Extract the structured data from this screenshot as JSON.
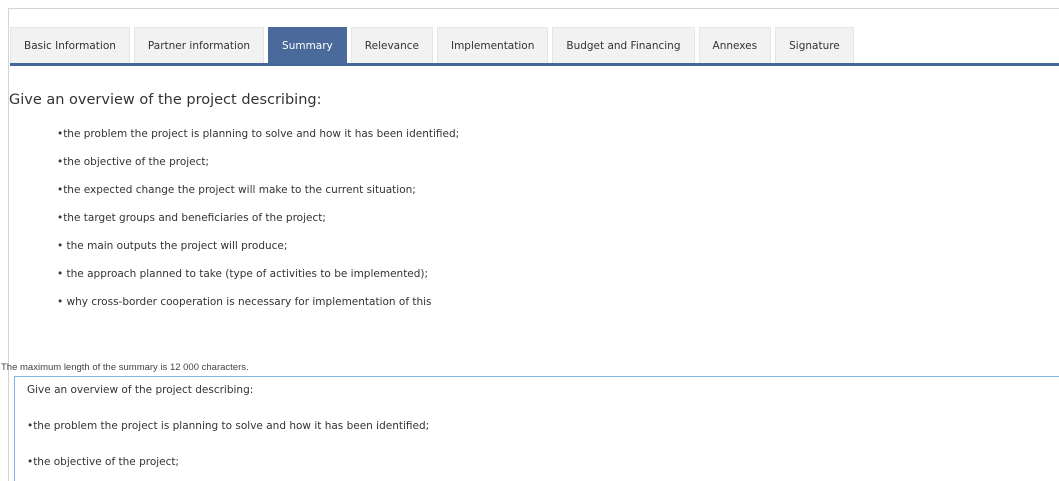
{
  "tabs": [
    {
      "label": "Basic Information",
      "active": false
    },
    {
      "label": "Partner information",
      "active": false
    },
    {
      "label": "Summary",
      "active": true
    },
    {
      "label": "Relevance",
      "active": false
    },
    {
      "label": "Implementation",
      "active": false
    },
    {
      "label": "Budget and Financing",
      "active": false
    },
    {
      "label": "Annexes",
      "active": false
    },
    {
      "label": "Signature",
      "active": false
    }
  ],
  "instructions": {
    "heading": "Give an overview of the project describing:",
    "bullets": [
      "•the problem the project is planning to solve and how it has been identified;",
      "•the objective of the project;",
      "•the expected change the project will make to the current situation;",
      "•the target groups and beneficiaries of the project;",
      "• the main outputs the project will produce;",
      "• the approach planned to take (type of activities to be implemented);",
      "• why cross-border cooperation is necessary for implementation of this"
    ]
  },
  "summary": {
    "max_length_note": "The maximum length of the summary is 12 000 characters.",
    "text_lines": [
      "Give an overview of the project describing:",
      "•the problem the project is planning to solve and how it has been identified;",
      "•the objective of the project;"
    ]
  },
  "colors": {
    "accent": "#4a6a9c",
    "input_border": "#7fb3e6"
  }
}
